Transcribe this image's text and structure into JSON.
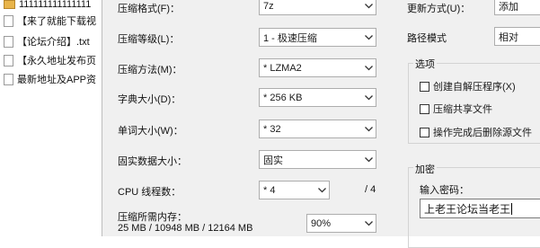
{
  "file_list": {
    "items": [
      {
        "label": "111111111111111",
        "icon": "folder-icon"
      },
      {
        "label": "【来了就能下载视",
        "icon": "file-icon"
      },
      {
        "label": "【论坛介绍】.txt",
        "icon": "file-icon"
      },
      {
        "label": "【永久地址发布页",
        "icon": "file-icon"
      },
      {
        "label": "最新地址及APP资",
        "icon": "file-icon"
      }
    ]
  },
  "settings": {
    "format_label": "压缩格式(F)：",
    "format_value": "7z",
    "level_label": "压缩等级(L)：",
    "level_value": "1 - 极速压缩",
    "method_label": "压缩方法(M)：",
    "method_value": "* LZMA2",
    "dict_label": "字典大小(D)：",
    "dict_value": "* 256 KB",
    "word_label": "单词大小(W)：",
    "word_value": "* 32",
    "solid_label": "固实数据大小：",
    "solid_value": "固实",
    "threads_label": "CPU 线程数：",
    "threads_value": "* 4",
    "threads_total": "/ 4",
    "memory_label": "压缩所需内存：",
    "memory_value": "25 MB / 10948 MB / 12164 MB",
    "memory_percent": "90%"
  },
  "right": {
    "update_label": "更新方式(U)：",
    "update_value": "添加",
    "path_label": "路径模式",
    "path_value": "相对",
    "options_title": "选项",
    "opt_sfx": "创建自解压程序(X)",
    "opt_shared": "压缩共享文件",
    "opt_delete": "操作完成后删除源文件",
    "encrypt_title": "加密",
    "pwd_label": "输入密码：",
    "pwd_value": "上老王论坛当老王"
  }
}
